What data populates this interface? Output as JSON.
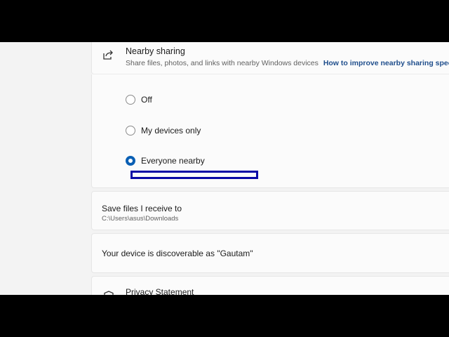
{
  "nearby_sharing": {
    "title": "Nearby sharing",
    "subtitle": "Share files, photos, and links with nearby Windows devices",
    "link": "How to improve nearby sharing speed",
    "icon": "share-icon",
    "options": [
      {
        "label": "Off",
        "checked": false
      },
      {
        "label": "My devices only",
        "checked": false
      },
      {
        "label": "Everyone nearby",
        "checked": true
      }
    ]
  },
  "save_files": {
    "title": "Save files I receive to",
    "path": "C:\\Users\\asus\\Downloads"
  },
  "discoverable": {
    "text": "Your device is discoverable as \"Gautam\""
  },
  "privacy": {
    "title": "Privacy Statement",
    "icon": "shield-icon"
  },
  "colors": {
    "accent": "#0a5fb4",
    "link": "#1f4e8c",
    "highlight_box": "#0a0aa6"
  }
}
